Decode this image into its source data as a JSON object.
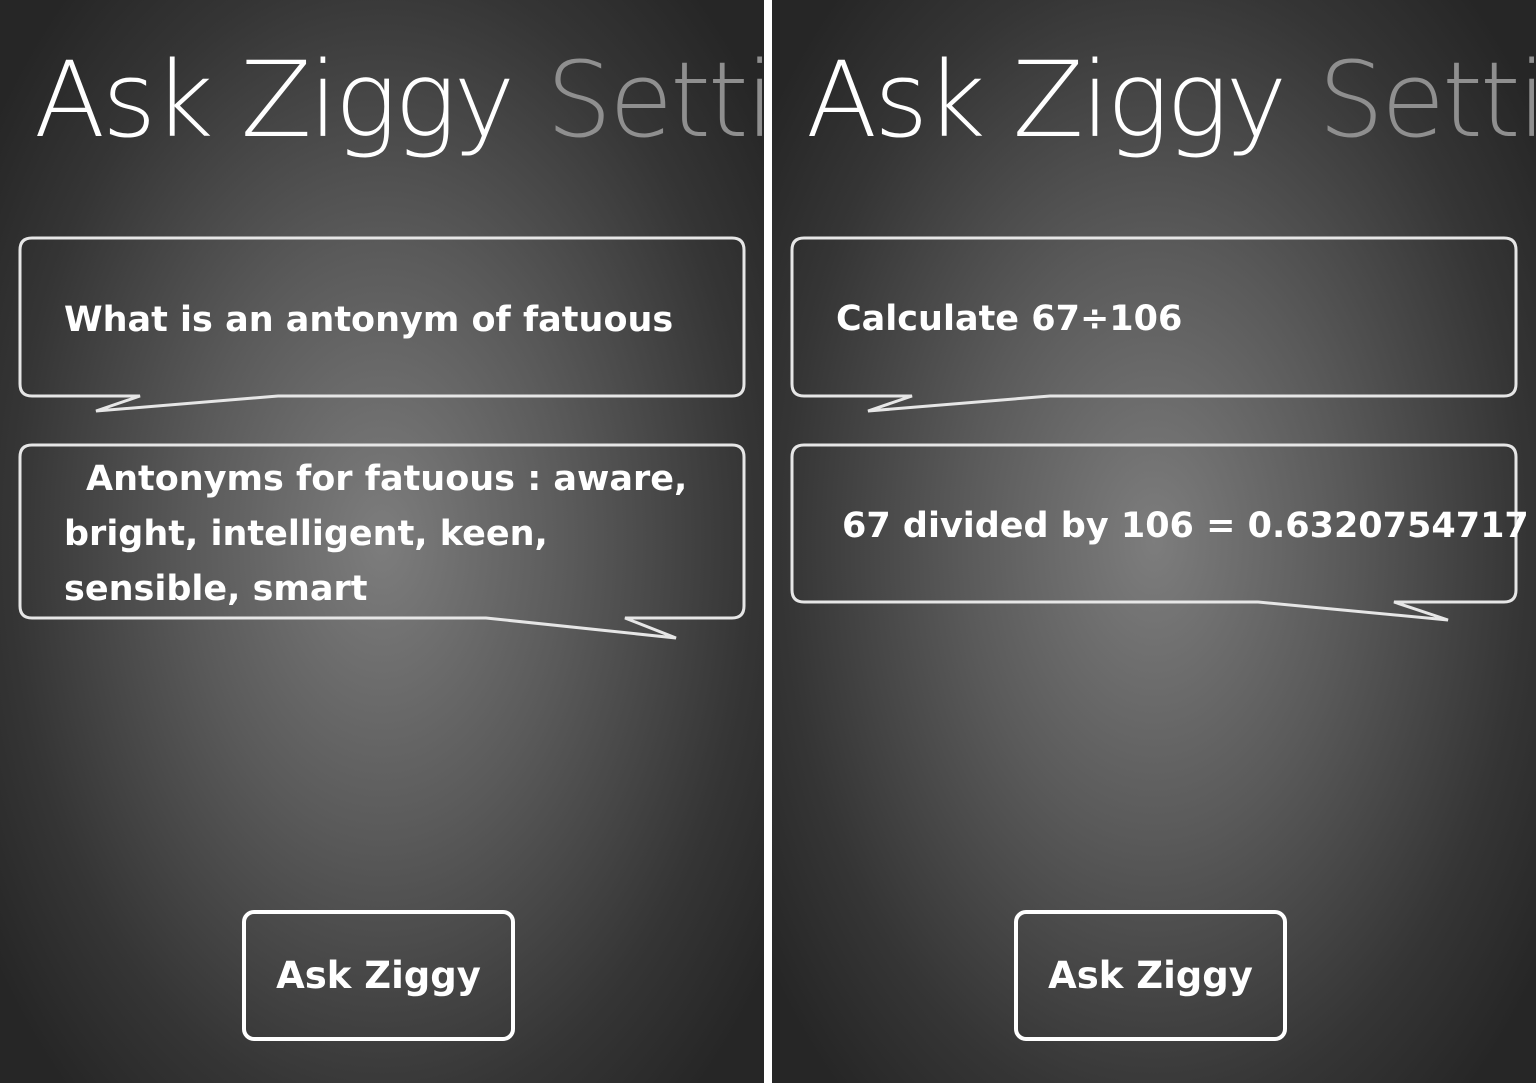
{
  "screens": [
    {
      "pivot": {
        "active": "Ask Ziggy",
        "next": "Setti"
      },
      "question": "What is an antonym of fatuous",
      "answer": "Antonyms for fatuous : aware, bright, intelligent, keen, sensible, smart",
      "button_label": "Ask Ziggy"
    },
    {
      "pivot": {
        "active": "Ask Ziggy",
        "next": "Setti"
      },
      "question": "Calculate 67÷106",
      "answer": "67 divided by 106 = 0.6320754717",
      "button_label": "Ask Ziggy"
    }
  ],
  "colors": {
    "text": "#ffffff",
    "inactive_pivot": "#8f8f8f",
    "bubble_border": "#e6e6e6"
  }
}
